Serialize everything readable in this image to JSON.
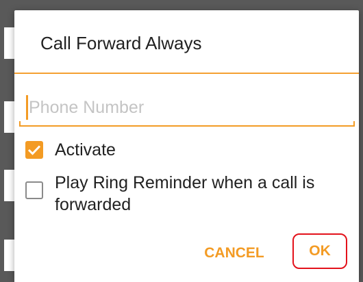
{
  "dialog": {
    "title": "Call Forward Always",
    "phone_field": {
      "value": "",
      "placeholder": "Phone Number"
    },
    "activate": {
      "label": "Activate",
      "checked": true
    },
    "ring_reminder": {
      "label": "Play Ring Reminder when a call is forwarded",
      "checked": false
    },
    "buttons": {
      "cancel_label": "CANCEL",
      "ok_label": "OK"
    }
  },
  "colors": {
    "accent": "#f39b24",
    "highlight_box": "#e3111a",
    "dim_overlay": "#595959"
  },
  "icons": {
    "checkbox_checked": "checkmark-icon"
  }
}
